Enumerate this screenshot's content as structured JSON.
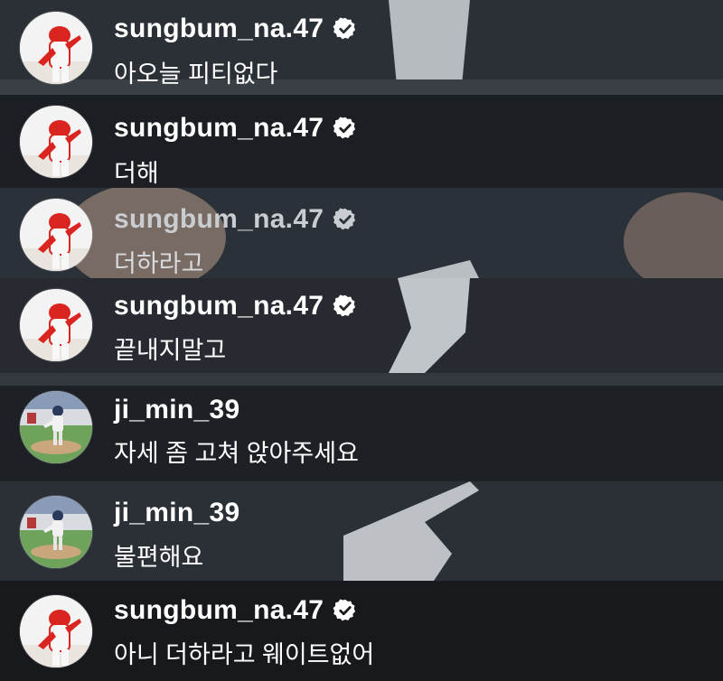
{
  "comments": [
    {
      "username": "sungbum_na.47",
      "verified": true,
      "text": "아오늘 피티없다",
      "avatar": "kia-tigers-player-avatar"
    },
    {
      "username": "sungbum_na.47",
      "verified": true,
      "text": "더해",
      "avatar": "kia-tigers-player-avatar"
    },
    {
      "username": "sungbum_na.47",
      "verified": true,
      "text": "더하라고",
      "avatar": "kia-tigers-player-avatar"
    },
    {
      "username": "sungbum_na.47",
      "verified": true,
      "text": "끝내지말고",
      "avatar": "kia-tigers-player-avatar"
    },
    {
      "username": "ji_min_39",
      "verified": false,
      "text": "자세 좀 고쳐 앉아주세요",
      "avatar": "pitcher-on-field-avatar"
    },
    {
      "username": "ji_min_39",
      "verified": false,
      "text": "불편해요",
      "avatar": "pitcher-on-field-avatar"
    },
    {
      "username": "sungbum_na.47",
      "verified": true,
      "text": "아니 더하라고 웨이트없어",
      "avatar": "kia-tigers-player-avatar"
    }
  ],
  "colors": {
    "text": "#ffffff",
    "verified_badge": "#ffffff",
    "background": "#1c1f24",
    "tigers_red": "#d9241f"
  }
}
